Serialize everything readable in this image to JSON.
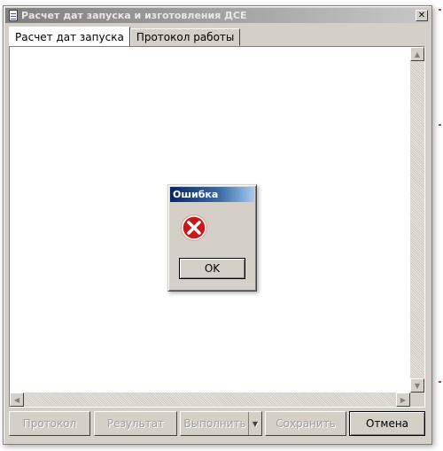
{
  "window": {
    "title": "Расчет дат запуска и изготовления ДСЕ",
    "close_glyph": "✕",
    "icon": "document-icon"
  },
  "tabs": [
    {
      "label": "Расчет дат запуска",
      "active": true
    },
    {
      "label": "Протокол работы",
      "active": false
    }
  ],
  "buttons": {
    "protocol": "Протокол",
    "result": "Результат",
    "execute": "Выполнить",
    "save": "Сохранить",
    "cancel": "Отмена"
  },
  "dialog": {
    "title": "Ошибка",
    "ok": "OK",
    "icon": "error-icon"
  },
  "colors": {
    "dialog_title": "#0a246a",
    "error_red": "#c81818"
  }
}
